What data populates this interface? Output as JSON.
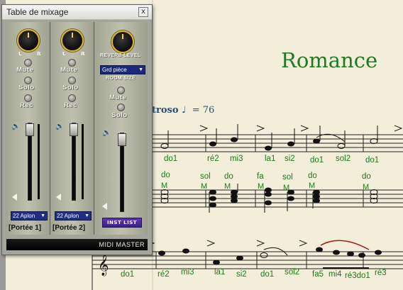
{
  "mixer": {
    "title": "Table de mixage",
    "close_label": "x",
    "knob_left": "L",
    "knob_right": "R",
    "channels": [
      {
        "mute": "Mute",
        "solo": "Solo",
        "rec": "Rec",
        "instrument": "22 Aplon",
        "name": "[Portée 1]"
      },
      {
        "mute": "Mute",
        "solo": "Solo",
        "rec": "Rec",
        "instrument": "22 Aplon",
        "name": "[Portée 2]"
      }
    ],
    "reverb": {
      "reverb_level": "REVERB LEVEL",
      "room_size_value": "Grd pièce",
      "room_size_label": "ROOM SIZE",
      "mute": "Mute",
      "solo": "Solo",
      "inst_list": "INST LIST"
    },
    "midi_master": "MIDI MASTER"
  },
  "score": {
    "title": "Romance",
    "tempo_text": "troso",
    "tempo_value": "= 76",
    "staff1_notes": [
      "do1",
      "ré2",
      "mi3",
      "la1",
      "si2",
      "do1",
      "sol2",
      "do1"
    ],
    "staff2_top": [
      "do",
      "sol",
      "do",
      "fa",
      "sol",
      "do",
      "do"
    ],
    "staff2_m": [
      "M",
      "M",
      "M",
      "M",
      "M",
      "M",
      "M"
    ],
    "staff3_notes": [
      "do1",
      "ré2",
      "mi3",
      "la1",
      "si2",
      "do1",
      "sol2",
      "fa5",
      "mi4",
      "ré3do1",
      "ré3"
    ]
  }
}
